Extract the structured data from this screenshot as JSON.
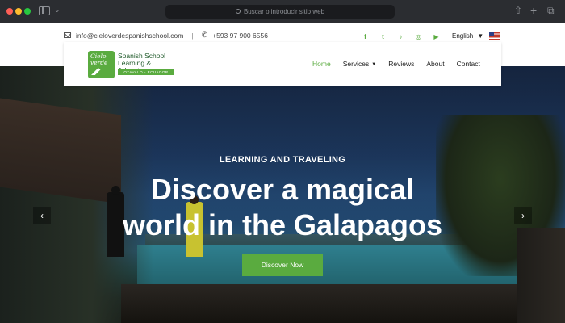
{
  "browser": {
    "url_placeholder": "Buscar o introducir sitio web",
    "share_icon": "share-icon",
    "new_tab_icon": "plus-icon",
    "tabs_icon": "tabs-overview-icon"
  },
  "topbar": {
    "email": "info@cieloverdespanishschool.com",
    "separator": "|",
    "phone": "+593 97 900 6556",
    "socials": [
      "facebook-icon",
      "twitter-icon",
      "tiktok-icon",
      "instagram-icon",
      "youtube-icon"
    ],
    "language": "English",
    "flag": "us-flag-icon"
  },
  "logo": {
    "badge_text": "Cielo verde",
    "line1": "Spanish School",
    "line2": "Learning & Adventure",
    "location": "OTAVALO - ECUADOR"
  },
  "nav": {
    "items": [
      {
        "label": "Home",
        "active": true
      },
      {
        "label": "Services",
        "dropdown": true
      },
      {
        "label": "Reviews"
      },
      {
        "label": "About"
      },
      {
        "label": "Contact"
      }
    ]
  },
  "hero": {
    "kicker": "LEARNING AND TRAVELING",
    "headline_line1": "Discover a magical",
    "headline_line2": "world in the Galapagos",
    "cta": "Discover Now",
    "prev_icon": "chevron-left-icon",
    "next_icon": "chevron-right-icon"
  },
  "colors": {
    "accent": "#5aab3f",
    "brand_dark": "#1f5a2a"
  }
}
